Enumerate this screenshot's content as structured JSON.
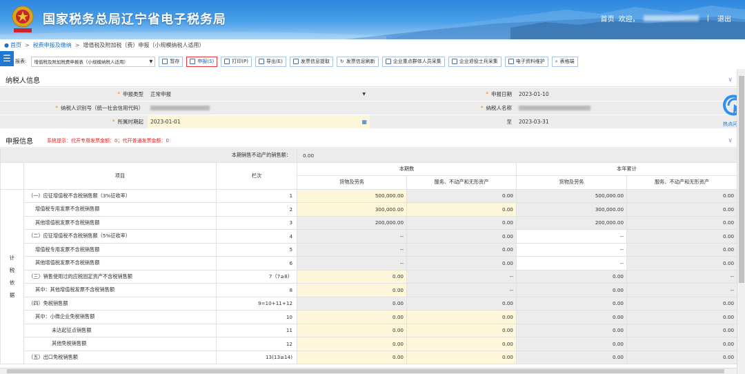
{
  "header": {
    "site_title": "国家税务总局辽宁省电子税务局",
    "nav_home": "首页",
    "nav_welcome": "欢迎，",
    "nav_separator": "|",
    "nav_logout": "退出"
  },
  "breadcrumb": {
    "home": "首页",
    "sep": ">",
    "level1": "税费申报及缴纳",
    "level2": "增值税及附加税（费）申报（小规模纳税人适用）"
  },
  "menu_tab": {
    "icon": "menu-icon",
    "glyph": "☰"
  },
  "toolbar": {
    "report_label": "报表:",
    "report_value": "增值税及附加税费申报表（小规模纳税人适用）",
    "buttons": {
      "save": "暂存",
      "declare": "申报(S)",
      "print": "打印(P)",
      "export": "导出(E)",
      "invoice_fetch": "发票信息提取",
      "invoice_refresh": "发票信息刷新",
      "key_personnel": "企业重点群体人员采集",
      "retired_soldiers": "企业退役士兵采集",
      "e_docs": "电子资料维护",
      "form_query": "表格端"
    }
  },
  "taxpayer_info": {
    "title": "纳税人信息",
    "decl_type_label": "申报类型",
    "decl_type_value": "正常申报",
    "decl_date_label": "申报日期",
    "decl_date_value": "2023-01-10",
    "taxpayer_id_label": "纳税人识别号（统一社会信用代码）",
    "taxpayer_name_label": "纳税人名称",
    "period_start_label": "所属时期起",
    "period_start_value": "2023-01-01",
    "period_end_label": "至",
    "period_end_value": "2023-03-31"
  },
  "declaration_info": {
    "title": "申报信息",
    "notice": "系统提示：代开专用发票金额：0；代开普通发票金额：0",
    "real_estate_label": "本期销售不动产的销售额：",
    "real_estate_value": "0.00"
  },
  "table": {
    "head_item": "项目",
    "head_seq": "栏次",
    "head_current": "本期数",
    "head_ytd": "本年累计",
    "head_goods": "货物及劳务",
    "head_services": "服务、不动产和无形资产",
    "side_label": "计税依据",
    "rows": [
      {
        "item": "（一）应征增值税不含税销售额（3%征收率）",
        "seq": "1",
        "c1": "500,000.00",
        "c2": "0.00",
        "c3": "500,000.00",
        "c4": "0.00"
      },
      {
        "item": "增值税专用发票不含税销售额",
        "seq": "2",
        "c1": "300,000.00",
        "c2": "0.00",
        "c3": "300,000.00",
        "c4": "0.00"
      },
      {
        "item": "其他增值税发票不含税销售额",
        "seq": "3",
        "c1": "200,000.00",
        "c2": "0.00",
        "c3": "200,000.00",
        "c4": "0.00"
      },
      {
        "item": "（二）应征增值税不含税销售额（5%征收率）",
        "seq": "4",
        "c1": "--",
        "c2": "0.00",
        "c3": "--",
        "c4": "0.00"
      },
      {
        "item": "增值税专用发票不含税销售额",
        "seq": "5",
        "c1": "--",
        "c2": "0.00",
        "c3": "--",
        "c4": "0.00"
      },
      {
        "item": "其他增值税发票不含税销售额",
        "seq": "6",
        "c1": "--",
        "c2": "0.00",
        "c3": "--",
        "c4": "0.00"
      },
      {
        "item": "（三）销售使用过的应税固定资产不含税销售额",
        "seq": "7（7≥8）",
        "c1": "0.00",
        "c2": "--",
        "c3": "0.00",
        "c4": "--"
      },
      {
        "item": "其中：其他增值税发票不含税销售额",
        "seq": "8",
        "c1": "0.00",
        "c2": "--",
        "c3": "0.00",
        "c4": "--"
      },
      {
        "item": "（四）免税销售额",
        "seq": "9=10+11+12",
        "c1": "0.00",
        "c2": "0.00",
        "c3": "0.00",
        "c4": "0.00"
      },
      {
        "item": "其中：小微企业免税销售额",
        "seq": "10",
        "c1": "0.00",
        "c2": "0.00",
        "c3": "0.00",
        "c4": "0.00"
      },
      {
        "item": "未达起征点销售额",
        "seq": "11",
        "c1": "0.00",
        "c2": "0.00",
        "c3": "0.00",
        "c4": "0.00"
      },
      {
        "item": "其他免税销售额",
        "seq": "12",
        "c1": "0.00",
        "c2": "0.00",
        "c3": "0.00",
        "c4": "0.00"
      },
      {
        "item": "（五）出口免税销售额",
        "seq": "13(13≥14)",
        "c1": "0.00",
        "c2": "0.00",
        "c3": "0.00",
        "c4": "0.00"
      }
    ]
  },
  "float_help": {
    "label": "热点问题"
  },
  "colors": {
    "accent": "#1e78d2",
    "highlight_input": "#fdf6d8",
    "readonly": "#ececec",
    "notice": "#e12121",
    "active_border": "#e3343a"
  }
}
